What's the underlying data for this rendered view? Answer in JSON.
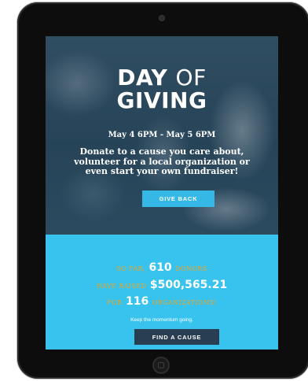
{
  "hero": {
    "title_bold_1": "DAY",
    "title_light": "OF",
    "title_bold_2": "GIVING",
    "dates": "May 4 6PM - May 5 6PM",
    "description": "Donate to a cause you care about, volunteer for a local organization or even start your own fundraiser!",
    "cta_label": "GIVE BACK"
  },
  "stats": {
    "line1_prefix": "SO FAR,",
    "donors_count": "610",
    "line1_suffix": "DONORS",
    "line2_prefix": "HAVE RAISED",
    "amount_raised": "$500,565.21",
    "line3_prefix": "FOR",
    "organizations_count": "116",
    "line3_suffix": "ORGANIZATIONS!",
    "momentum_text": "Keep the momentum going.",
    "cta_label": "FIND A CAUSE"
  },
  "colors": {
    "accent_blue": "#38c3ee",
    "accent_orange": "#f3a31a",
    "dark_button": "#2a3e52"
  }
}
